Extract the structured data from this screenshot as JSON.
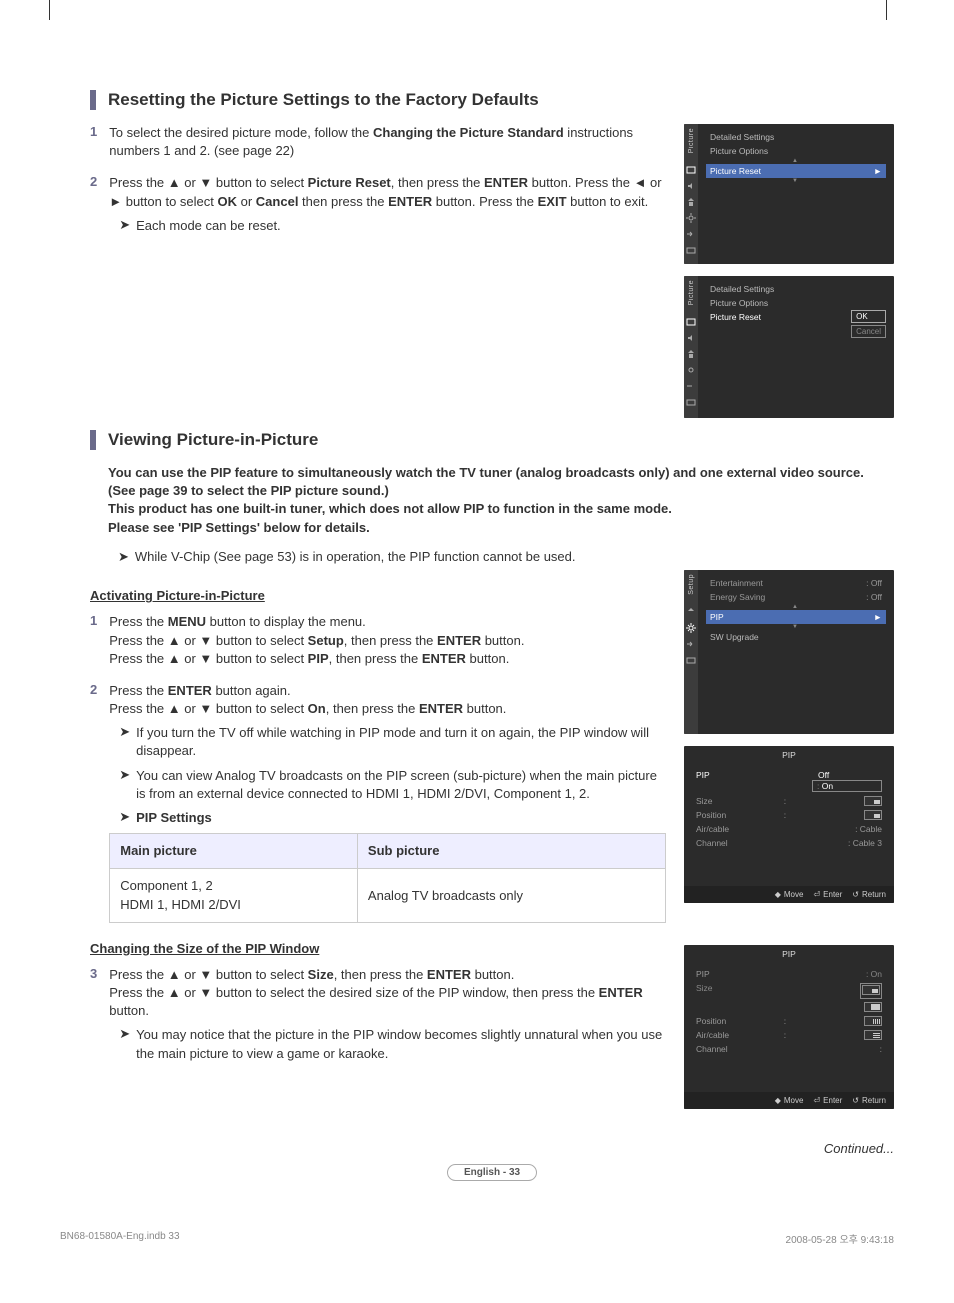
{
  "section1": {
    "title": "Resetting the Picture Settings to the Factory Defaults",
    "step1": "To select the desired picture mode, follow the Changing the Picture Standard instructions numbers 1 and 2. (see page 22)",
    "step1_bold": "Changing the Picture Standard",
    "step2_html": "Press the ▲ or ▼ button to select Picture Reset, then press the ENTER button. Press the ◄ or ► button to select OK or Cancel then press the ENTER button. Press the EXIT button to exit.",
    "step2_note": "Each mode can be reset."
  },
  "osd1": {
    "side_label": "Picture",
    "lines": [
      "Detailed Settings",
      "Picture Options"
    ],
    "highlight": "Picture Reset",
    "arrow": "►"
  },
  "osd2": {
    "side_label": "Picture",
    "lines": [
      "Detailed Settings",
      "Picture Options"
    ],
    "row_label": "Picture Reset",
    "popup": [
      "OK",
      "Cancel"
    ]
  },
  "section2": {
    "title": "Viewing Picture-in-Picture",
    "intro1": "You can use the PIP feature to simultaneously watch the TV tuner (analog broadcasts only) and one external video source. (See page 39 to select the PIP picture sound.)",
    "intro2": "This product has one built-in tuner, which does not allow PIP to function in the same mode.",
    "intro3": "Please see 'PIP Settings' below for details.",
    "note_vchip": "While V-Chip (See page 53) is in operation, the PIP function cannot be used.",
    "sub_activating": "Activating Picture-in-Picture",
    "step1_l1": "Press the MENU button to display the menu.",
    "step1_l2": "Press the ▲ or ▼ button to select Setup, then press the ENTER button.",
    "step1_l3": "Press the ▲ or ▼ button to select PIP, then press the ENTER button.",
    "step2_l1": "Press the ENTER button again.",
    "step2_l2": "Press the ▲ or ▼ button to select On, then press the ENTER button.",
    "step2_note1": "If you turn the TV off while watching in PIP mode and turn it on again, the PIP window will disappear.",
    "step2_note2": "You can view Analog TV broadcasts on the PIP screen (sub-picture) when the main picture is from an external device connected to HDMI 1, HDMI 2/DVI, Component 1, 2.",
    "pip_settings_label": "PIP Settings",
    "table_h1": "Main picture",
    "table_h2": "Sub picture",
    "table_c1": "Component 1, 2\nHDMI 1, HDMI 2/DVI",
    "table_c2": "Analog TV broadcasts only",
    "sub_size": "Changing the Size of the PIP Window",
    "step3_l1": "Press the ▲ or ▼ button to select Size, then press the ENTER button.",
    "step3_l2": "Press the ▲ or ▼ button to select the desired size of the PIP window, then press the ENTER button.",
    "step3_note": "You may notice that the picture in the PIP window becomes slightly unnatural when you use the main picture to view a game or karaoke.",
    "continued": "Continued..."
  },
  "osd3": {
    "side_label": "Setup",
    "rows": [
      {
        "lbl": "Entertainment",
        "val": ": Off"
      },
      {
        "lbl": "Energy Saving",
        "val": ": Off"
      }
    ],
    "highlight": "PIP",
    "arrow": "►",
    "after": "SW Upgrade"
  },
  "osd4": {
    "title": "PIP",
    "rows": [
      {
        "lbl": "PIP",
        "val": "Off",
        "sel": true,
        "opt": "On"
      },
      {
        "lbl": "Size",
        "val": ":"
      },
      {
        "lbl": "Position",
        "val": ":"
      },
      {
        "lbl": "Air/cable",
        "val": ": Cable"
      },
      {
        "lbl": "Channel",
        "val": ": Cable 3"
      }
    ],
    "footer": {
      "move": "Move",
      "enter": "Enter",
      "return": "Return"
    }
  },
  "osd5": {
    "title": "PIP",
    "rows": [
      {
        "lbl": "PIP",
        "val": ": On"
      },
      {
        "lbl": "Size",
        "val": ":"
      },
      {
        "lbl": "Position",
        "val": ":"
      },
      {
        "lbl": "Air/cable",
        "val": ":"
      },
      {
        "lbl": "Channel",
        "val": ":"
      }
    ],
    "footer": {
      "move": "Move",
      "enter": "Enter",
      "return": "Return"
    }
  },
  "symbols": {
    "chev": "➤",
    "updown": "◆",
    "enter": "⏎",
    "return": "↺"
  },
  "page_badge": "English - 33",
  "footer": {
    "file": "BN68-01580A-Eng.indb   33",
    "stamp": "2008-05-28   오후 9:43:18"
  }
}
